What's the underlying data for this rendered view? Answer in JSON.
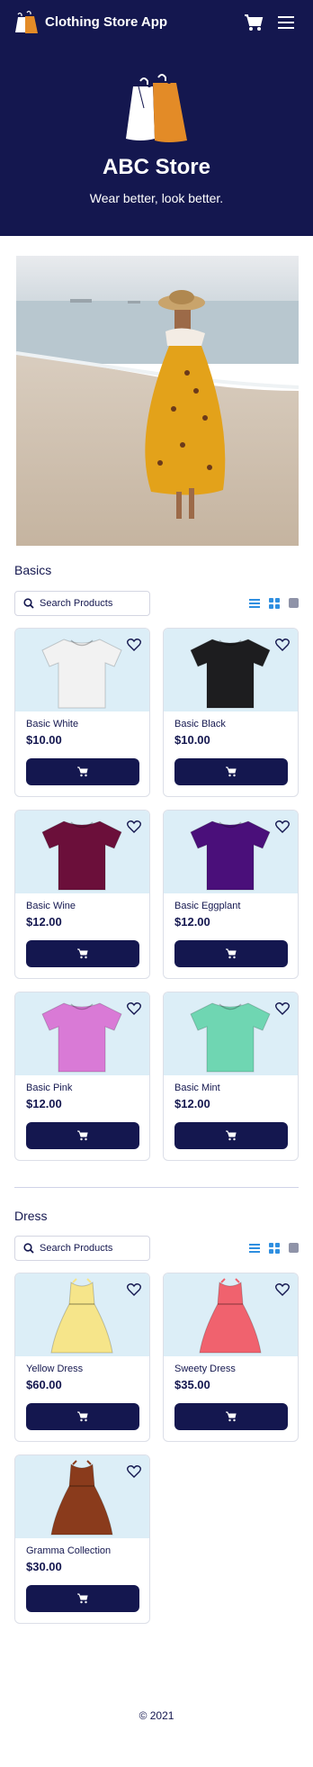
{
  "header": {
    "app_title": "Clothing Store App",
    "store_name": "ABC Store",
    "tagline": "Wear better, look better."
  },
  "banner": {
    "alt": "Woman walking on beach in floral skirt"
  },
  "sections": [
    {
      "title": "Basics",
      "search_placeholder": "Search Products",
      "products": [
        {
          "name": "Basic White",
          "price": "$10.00",
          "color": "#f2f2f2",
          "type": "tshirt"
        },
        {
          "name": "Basic Black",
          "price": "$10.00",
          "color": "#1d1d1f",
          "type": "tshirt"
        },
        {
          "name": "Basic Wine",
          "price": "$12.00",
          "color": "#6b0f3a",
          "type": "tshirt"
        },
        {
          "name": "Basic Eggplant",
          "price": "$12.00",
          "color": "#4a0f7a",
          "type": "tshirt"
        },
        {
          "name": "Basic Pink",
          "price": "$12.00",
          "color": "#d97ad6",
          "type": "tshirt"
        },
        {
          "name": "Basic Mint",
          "price": "$12.00",
          "color": "#6fd6b2",
          "type": "tshirt"
        }
      ]
    },
    {
      "title": "Dress",
      "search_placeholder": "Search Products",
      "products": [
        {
          "name": "Yellow Dress",
          "price": "$60.00",
          "color": "#f6e58a",
          "type": "dress"
        },
        {
          "name": "Sweety Dress",
          "price": "$35.00",
          "color": "#f0626e",
          "type": "dress"
        },
        {
          "name": "Gramma Collection",
          "price": "$30.00",
          "color": "#8a3b1c",
          "type": "dress"
        }
      ]
    }
  ],
  "footer": {
    "copyright": "© 2021"
  },
  "colors": {
    "navy": "#14174f",
    "card_bg": "#dceef7",
    "accent_blue": "#2f8fe0"
  }
}
